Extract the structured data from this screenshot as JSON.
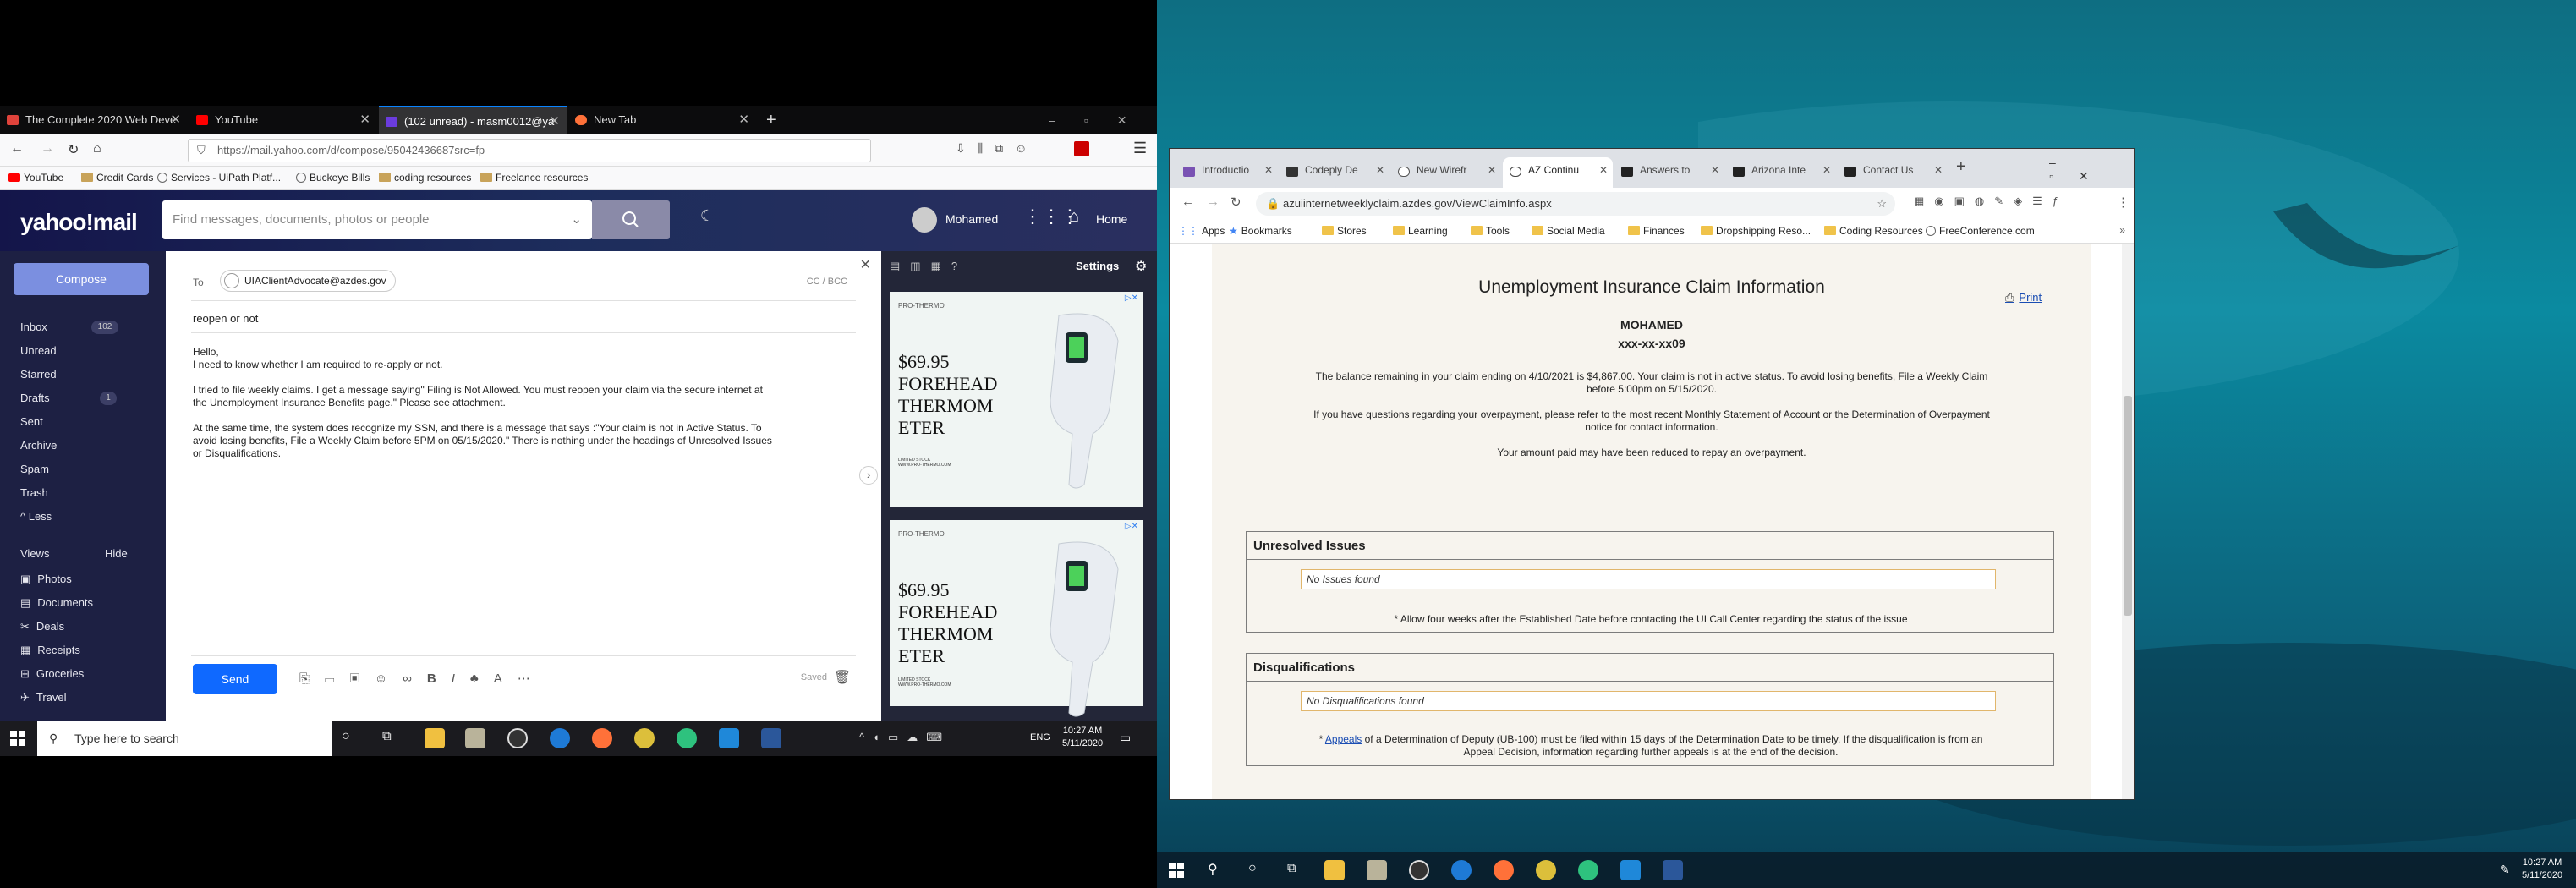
{
  "left": {
    "firefox": {
      "tabs": [
        {
          "label": "The Complete 2020 Web Deve",
          "color": "#e0433b"
        },
        {
          "label": "YouTube",
          "color": "#ff0000"
        },
        {
          "label": "(102 unread) - masm0012@ya",
          "color": "#6b3cde"
        },
        {
          "label": "New Tab",
          "color": "#ff7139"
        }
      ],
      "url": "https://mail.yahoo.com/d/compose/95042436687src=fp",
      "bookmarks": [
        "YouTube",
        "Credit Cards",
        "Services - UiPath Platf...",
        "Buckeye Bills",
        "coding resources",
        "Freelance resources"
      ]
    },
    "yahoo": {
      "logo": "yahoo!mail",
      "search_placeholder": "Find messages, documents, photos or people",
      "user": "Mohamed",
      "home": "Home",
      "settings": "Settings",
      "compose": "Compose",
      "folders": [
        {
          "label": "Inbox",
          "badge": "102"
        },
        {
          "label": "Unread",
          "badge": ""
        },
        {
          "label": "Starred",
          "badge": ""
        },
        {
          "label": "Drafts",
          "badge": "1"
        },
        {
          "label": "Sent",
          "badge": ""
        },
        {
          "label": "Archive",
          "badge": ""
        },
        {
          "label": "Spam",
          "badge": ""
        },
        {
          "label": "Trash",
          "badge": ""
        },
        {
          "label": "^ Less",
          "badge": ""
        }
      ],
      "views_label": "Views",
      "hide_label": "Hide",
      "views": [
        "Photos",
        "Documents",
        "Deals",
        "Receipts",
        "Groceries",
        "Travel"
      ],
      "compose_form": {
        "to_label": "To",
        "recipient": "UIAClientAdvocate@azdes.gov",
        "cc_bcc": "CC / BCC",
        "subject": "reopen or not",
        "body": [
          "Hello,",
          "I need to know whether I am required to re-apply or not.",
          "",
          "I tried to file weekly claims. I get a message saying\" Filing is Not Allowed. You must reopen your claim via the secure internet at",
          "the Unemployment Insurance Benefits page.\" Please see attachment.",
          "",
          "At the same time, the system does recognize my SSN, and there is a message that says :\"Your claim is not in Active Status. To",
          "avoid losing benefits, File a Weekly Claim before 5PM on 05/15/2020.\" There is nothing under the headings of Unresolved Issues",
          "or Disqualifications."
        ],
        "send": "Send",
        "saved": "Saved"
      },
      "ads": [
        {
          "brand": "PRO-THERMO",
          "text": "$69.95 FOREHEAD THERMOM ETER",
          "small": "LIMITED STOCK\nWWW.PRO-THERMO.COM"
        },
        {
          "brand": "PRO-THERMO",
          "text": "$69.95 FOREHEAD THERMOM ETER",
          "small": "LIMITED STOCK\nWWW.PRO-THERMO.COM"
        }
      ]
    },
    "taskbar": {
      "search_placeholder": "Type here to search",
      "lang": "ENG",
      "time": "10:27 AM",
      "date": "5/11/2020"
    }
  },
  "right": {
    "chrome": {
      "tabs": [
        {
          "label": "Introductio",
          "color": "#7952b3"
        },
        {
          "label": "Codeply De",
          "color": "#333333"
        },
        {
          "label": "New Wirefr",
          "color": "#555555"
        },
        {
          "label": "AZ Continu",
          "color": "#444444"
        },
        {
          "label": "Answers to",
          "color": "#222222"
        },
        {
          "label": "Arizona Inte",
          "color": "#222222"
        },
        {
          "label": "Contact Us",
          "color": "#222222"
        }
      ],
      "url": "azuiinternetweeklyclaim.azdes.gov/ViewClaimInfo.aspx",
      "bookmarks": [
        "Apps",
        "Bookmarks",
        "Stores",
        "Learning",
        "Tools",
        "Social Media",
        "Finances",
        "Dropshipping Reso...",
        "Coding Resources",
        "FreeConference.com"
      ]
    },
    "claim": {
      "title": "Unemployment Insurance Claim Information",
      "print": "Print",
      "name": "MOHAMED",
      "ssn": "xxx-xx-xx09",
      "para1_line1": "The balance remaining in your claim ending on 4/10/2021 is $4,867.00. Your claim is not in active status. To avoid losing benefits, File a Weekly Claim",
      "para1_line2": "before 5:00pm on 5/15/2020.",
      "para2_line1": "If you have questions regarding your overpayment, please refer to the most recent Monthly Statement of Account or the Determination of Overpayment",
      "para2_line2": "notice for contact information.",
      "para3": "Your amount paid may have been reduced to repay an overpayment.",
      "unresolved_title": "Unresolved Issues",
      "unresolved_value": "No Issues found",
      "unresolved_note": "* Allow four weeks after the Established Date before contacting the UI Call Center regarding the status of the issue",
      "disq_title": "Disqualifications",
      "disq_value": "No Disqualifications found",
      "disq_note_star": "* ",
      "disq_note_link": "Appeals",
      "disq_note_rest": " of a Determination of Deputy (UB-100) must be filed within 15 days of the Determination Date to be timely. If the disqualification is from an",
      "disq_note_line2": "Appeal Decision, information regarding further appeals is at the end of the decision."
    },
    "taskbar": {
      "time": "10:27 AM",
      "date": "5/11/2020"
    }
  }
}
